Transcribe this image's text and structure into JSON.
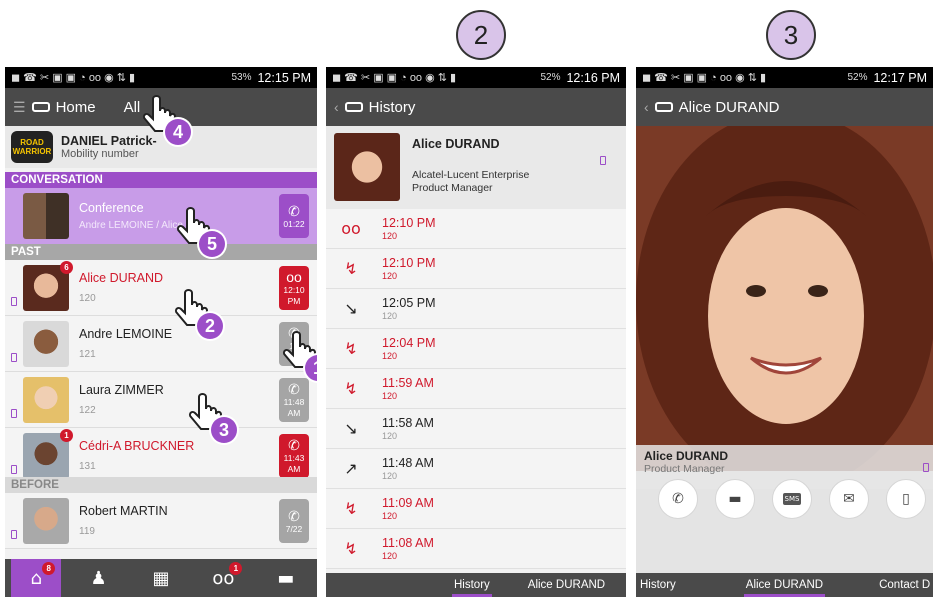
{
  "steps": [
    "2",
    "3"
  ],
  "status_bars": [
    {
      "battery": "53%",
      "time": "12:15 PM"
    },
    {
      "battery": "52%",
      "time": "12:16 PM"
    },
    {
      "battery": "52%",
      "time": "12:17 PM"
    }
  ],
  "screen1": {
    "title": "Home",
    "filter": "All",
    "user": {
      "name": "DANIEL Patrick-",
      "subtitle": "Mobility number",
      "badge_line1": "ROAD",
      "badge_line2": "WARRIOR"
    },
    "conversation_header": "CONVERSATION",
    "conference": {
      "title": "Conference",
      "subtitle": "Andre LEMOINE / Alice D",
      "duration": "01:22"
    },
    "past_header": "PAST",
    "past": [
      {
        "name": "Alice DURAND",
        "number": "120",
        "badge": "6",
        "tile_line1": "12:10",
        "tile_line2": "PM",
        "missed": true
      },
      {
        "name": "Andre LEMOINE",
        "number": "121",
        "badge": "",
        "tile_line1": "12",
        "tile_line2": "P",
        "missed": false
      },
      {
        "name": "Laura ZIMMER",
        "number": "122",
        "badge": "",
        "tile_line1": "11:48",
        "tile_line2": "AM",
        "missed": false
      },
      {
        "name": "Cédri-A BRUCKNER",
        "number": "131",
        "badge": "1",
        "tile_line1": "11:43",
        "tile_line2": "AM",
        "missed": true
      }
    ],
    "before_header": "BEFORE",
    "before": [
      {
        "name": "Robert MARTIN",
        "number": "119",
        "tile_line1": "7/22"
      }
    ],
    "nav_badges": {
      "home": "8",
      "voicemail": "1"
    },
    "hands": [
      "4",
      "5",
      "2",
      "1",
      "3"
    ]
  },
  "screen2": {
    "title": "History",
    "contact": {
      "name": "Alice DURAND",
      "company": "Alcatel-Lucent Enterprise",
      "role": "Product Manager"
    },
    "history": [
      {
        "time": "12:10 PM",
        "number": "120",
        "type": "voicemail",
        "missed": true
      },
      {
        "time": "12:10 PM",
        "number": "120",
        "type": "missed",
        "missed": true
      },
      {
        "time": "12:05 PM",
        "number": "120",
        "type": "incoming",
        "missed": false
      },
      {
        "time": "12:04 PM",
        "number": "120",
        "type": "missed",
        "missed": true
      },
      {
        "time": "11:59 AM",
        "number": "120",
        "type": "missed",
        "missed": true
      },
      {
        "time": "11:58 AM",
        "number": "120",
        "type": "incoming",
        "missed": false
      },
      {
        "time": "11:48 AM",
        "number": "120",
        "type": "outgoing",
        "missed": false
      },
      {
        "time": "11:09 AM",
        "number": "120",
        "type": "missed",
        "missed": true
      },
      {
        "time": "11:08 AM",
        "number": "120",
        "type": "missed",
        "missed": true
      }
    ],
    "tabs": [
      "History",
      "Alice DURAND"
    ]
  },
  "screen3": {
    "title": "Alice DURAND",
    "name": "Alice DURAND",
    "role": "Product Manager",
    "actions": [
      "call-icon",
      "chat-icon",
      "sms-icon",
      "email-icon",
      "mobile-icon"
    ],
    "sms_label": "SMS",
    "tabs": [
      "History",
      "Alice DURAND",
      "Contact D"
    ]
  }
}
